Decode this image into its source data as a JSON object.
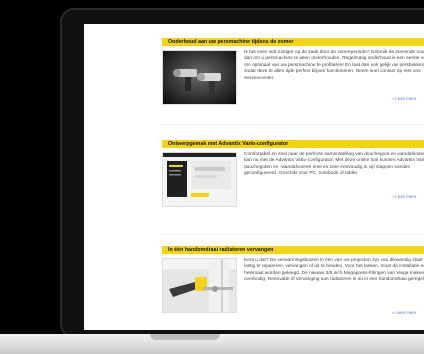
{
  "articles": [
    {
      "title": "Onderhoud aan uw persmachine tijdens de zomer",
      "body": "Is het even wat rustiger op de zaak door de zomerperiode? Gebruik de komende maanden dan om u persmachine te laten onderhouden. Regelmatig onderhoud is een eerste vereiste om optimaal van uw persmachine te profiteren! En laat dan ook gelijk uw persbekken keuren zodat deze te allen tijde perfect blijven functioneren. Neem snel contact op met ons Servicecenter.",
      "read_more": "Lees meer"
    },
    {
      "title": "Ontwerpgemak met Advantix Vario-configurator",
      "body": "Comfortabel en snel naar de perfecte samenstelling van douchegoot en wandafvoeren? Dat kan nu met de Advantix Vario-configurator. Met deze online tool kunnen Advantix Vario-douchegoten en -wandafvoeren snel en zeer eenvoudig in vijf stappen worden geconfigureerd. Geschikt voor PC, notebook of tablet.",
      "read_more": "Lees meer"
    },
    {
      "title": "In één handomdraai radiatoren vervangen",
      "body": "Kent u dat? De verwarmingsbuizen in één van uw projecten zijn van dikwandig staal en dus lastig te repareren, vervangen of uit te breiden. Voor het lassen, moet de installatie eerst helemaal worden geleegd. De nieuwe 3/8 inch Megapress-fittingen van Viega maken dat nu overbodig. Renovatie of vervanging van radiatoren is nu in een handomdraai geregeld...",
      "read_more": "Lees meer"
    }
  ]
}
